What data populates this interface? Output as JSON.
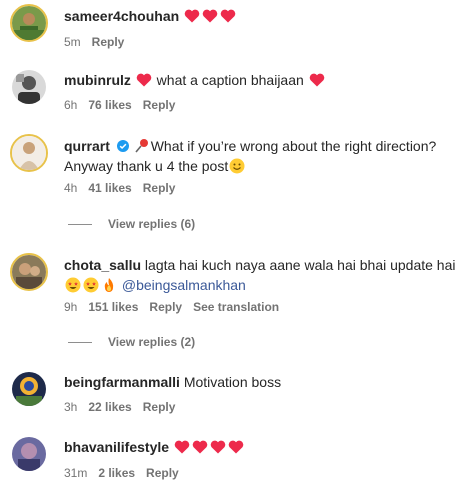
{
  "comments": [
    {
      "user": "sameer4chouhan",
      "text": "",
      "hearts": 3,
      "time": "5m",
      "likes": "",
      "reply": "Reply"
    },
    {
      "user": "mubinrulz",
      "text_before": "",
      "text": "what a caption bhaijaan",
      "time": "6h",
      "likes": "76 likes",
      "reply": "Reply"
    },
    {
      "user": "qurrart",
      "text_line1": "What if you’re wrong about the right direction?",
      "text_line2": "Anyway thank u 4 the post",
      "time": "4h",
      "likes": "41 likes",
      "reply": "Reply"
    },
    {
      "user": "chota_sallu",
      "text_line1": "lagta hai kuch naya aane wala hai bhai update hai",
      "mention": "@beingsalmankhan",
      "time": "9h",
      "likes": "151 likes",
      "reply": "Reply",
      "see_translation": "See translation"
    },
    {
      "user": "beingfarmanmalli",
      "text": "Motivation boss",
      "time": "3h",
      "likes": "22 likes",
      "reply": "Reply"
    },
    {
      "user": "bhavanilifestyle",
      "text": "",
      "hearts": 4,
      "time": "31m",
      "likes": "2 likes",
      "reply": "Reply"
    }
  ],
  "view_replies": [
    "View replies (6)",
    "View replies (2)"
  ],
  "icons": {
    "heart": "heart-icon",
    "pin": "pushpin-icon",
    "verified": "verified-badge-icon",
    "smile": "smiling-face-icon",
    "star_eyes": "star-struck-icon",
    "fire": "fire-icon"
  },
  "colors": {
    "heart": "#ed2a4b",
    "meta": "#737373",
    "mention": "#3b5998",
    "verified": "#1d9bf0"
  }
}
